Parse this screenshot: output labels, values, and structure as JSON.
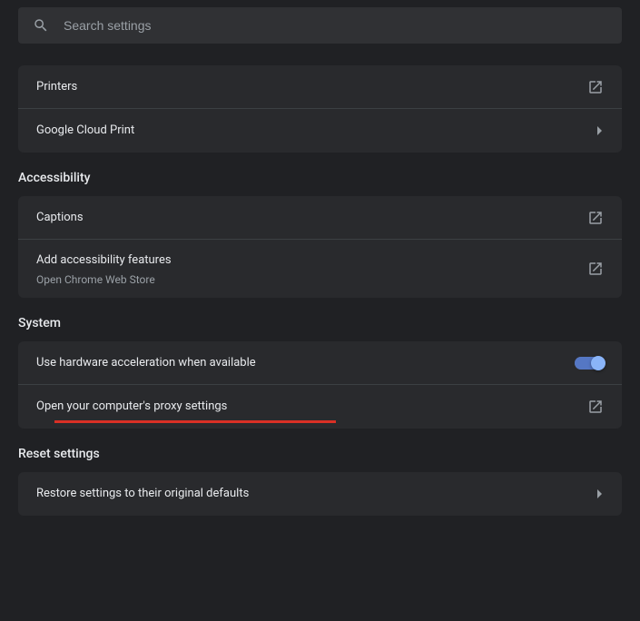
{
  "search": {
    "placeholder": "Search settings"
  },
  "sections": {
    "printing": {
      "printers_label": "Printers",
      "gcp_label": "Google Cloud Print"
    },
    "accessibility": {
      "title": "Accessibility",
      "captions_label": "Captions",
      "add_features_label": "Add accessibility features",
      "add_features_sub": "Open Chrome Web Store"
    },
    "system": {
      "title": "System",
      "hw_accel_label": "Use hardware acceleration when available",
      "hw_accel_on": true,
      "proxy_label": "Open your computer's proxy settings"
    },
    "reset": {
      "title": "Reset settings",
      "restore_label": "Restore settings to their original defaults"
    }
  }
}
